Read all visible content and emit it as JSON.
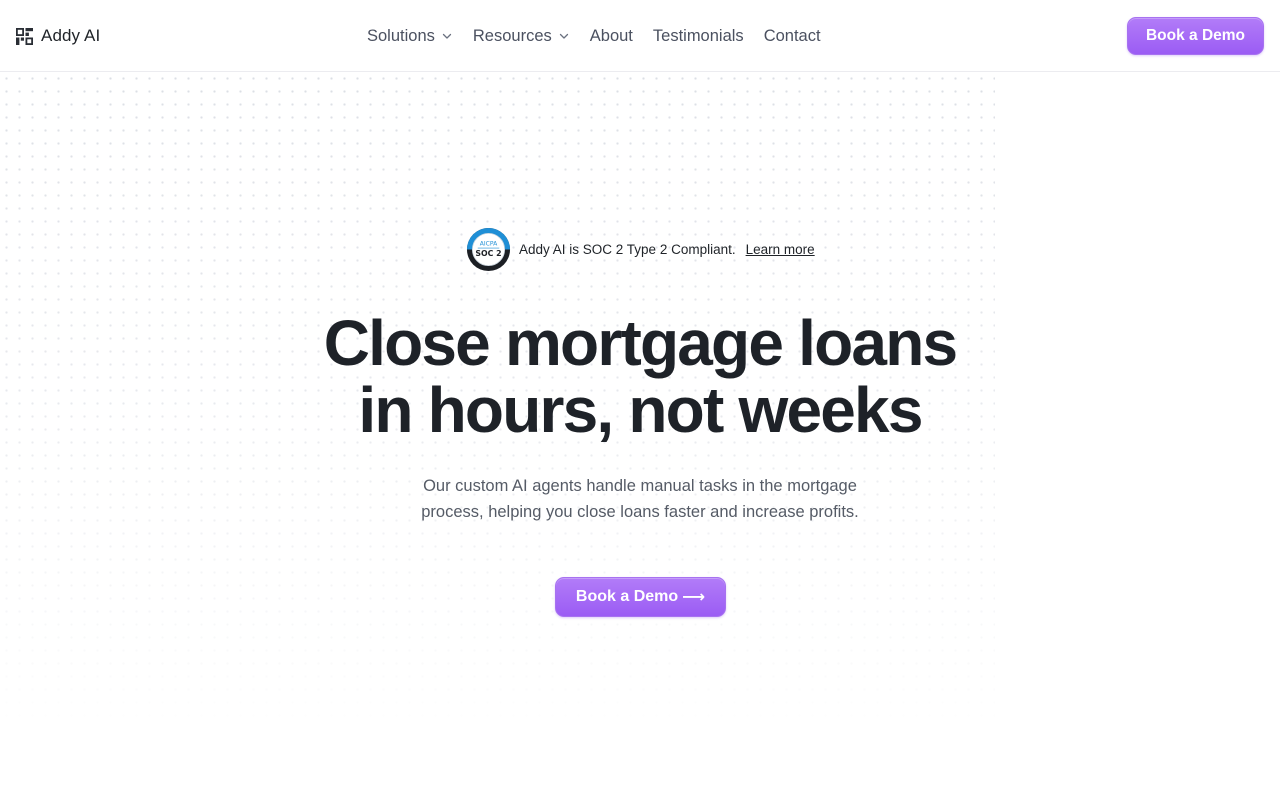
{
  "header": {
    "brand": "Addy AI",
    "logo_icon": "addy-logo-icon",
    "nav": [
      {
        "label": "Solutions",
        "has_dropdown": true
      },
      {
        "label": "Resources",
        "has_dropdown": true
      },
      {
        "label": "About",
        "has_dropdown": false
      },
      {
        "label": "Testimonials",
        "has_dropdown": false
      },
      {
        "label": "Contact",
        "has_dropdown": false
      }
    ],
    "cta_label": "Book a Demo"
  },
  "hero": {
    "badge": {
      "icon": "aicpa-soc2-badge-icon",
      "icon_text_top": "AICPA",
      "icon_text_main": "SOC 2",
      "text": "Addy AI is SOC 2 Type 2 Compliant.",
      "link_label": "Learn more"
    },
    "headline_line1": "Close mortgage loans",
    "headline_line2": "in hours, not weeks",
    "subtext_line1": "Our custom AI agents handle manual tasks in the mortgage",
    "subtext_line2": "process, helping you close loans faster and increase profits.",
    "cta_label": "Book a Demo",
    "cta_arrow": "⟶"
  },
  "colors": {
    "accent": "#9b5cf4",
    "accent_light": "#b27cf8",
    "heading": "#1e2228",
    "body_text": "#555b66",
    "nav_text": "#4b5160",
    "badge_blue": "#1f8fd6"
  }
}
